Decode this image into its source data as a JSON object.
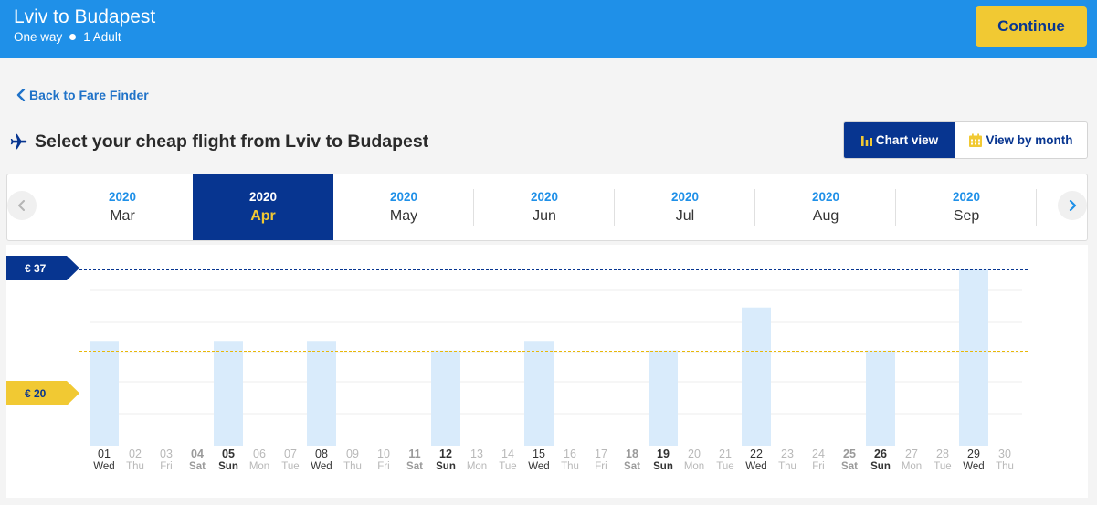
{
  "header": {
    "route_title": "Lviv to Budapest",
    "trip_type": "One way",
    "passengers": "1 Adult",
    "continue_label": "Continue",
    "colors": {
      "bar": "#1f90e8",
      "accent": "#f1c933",
      "navy": "#073590"
    }
  },
  "back_link": "Back to Fare Finder",
  "heading": "Select your cheap flight from Lviv to Budapest",
  "view_toggle": {
    "chart_label": "Chart view",
    "month_label": "View by month",
    "active": "chart"
  },
  "months": [
    {
      "year": "2020",
      "month": "Mar",
      "selected": false
    },
    {
      "year": "2020",
      "month": "Apr",
      "selected": true
    },
    {
      "year": "2020",
      "month": "May",
      "selected": false
    },
    {
      "year": "2020",
      "month": "Jun",
      "selected": false
    },
    {
      "year": "2020",
      "month": "Jul",
      "selected": false
    },
    {
      "year": "2020",
      "month": "Aug",
      "selected": false
    },
    {
      "year": "2020",
      "month": "Sep",
      "selected": false
    }
  ],
  "price_markers": {
    "max_label": "€ 37",
    "min_label": "€ 20"
  },
  "chart_data": {
    "type": "bar",
    "ylim": [
      0,
      37
    ],
    "max_price": 37,
    "min_price": 20,
    "days": [
      {
        "num": "01",
        "name": "Wed",
        "price": 22
      },
      {
        "num": "02",
        "name": "Thu",
        "price": null
      },
      {
        "num": "03",
        "name": "Fri",
        "price": null
      },
      {
        "num": "04",
        "name": "Sat",
        "price": null
      },
      {
        "num": "05",
        "name": "Sun",
        "price": 22
      },
      {
        "num": "06",
        "name": "Mon",
        "price": null
      },
      {
        "num": "07",
        "name": "Tue",
        "price": null
      },
      {
        "num": "08",
        "name": "Wed",
        "price": 22
      },
      {
        "num": "09",
        "name": "Thu",
        "price": null
      },
      {
        "num": "10",
        "name": "Fri",
        "price": null
      },
      {
        "num": "11",
        "name": "Sat",
        "price": null
      },
      {
        "num": "12",
        "name": "Sun",
        "price": 20
      },
      {
        "num": "13",
        "name": "Mon",
        "price": null
      },
      {
        "num": "14",
        "name": "Tue",
        "price": null
      },
      {
        "num": "15",
        "name": "Wed",
        "price": 22
      },
      {
        "num": "16",
        "name": "Thu",
        "price": null
      },
      {
        "num": "17",
        "name": "Fri",
        "price": null
      },
      {
        "num": "18",
        "name": "Sat",
        "price": null
      },
      {
        "num": "19",
        "name": "Sun",
        "price": 20
      },
      {
        "num": "20",
        "name": "Mon",
        "price": null
      },
      {
        "num": "21",
        "name": "Tue",
        "price": null
      },
      {
        "num": "22",
        "name": "Wed",
        "price": 29
      },
      {
        "num": "23",
        "name": "Thu",
        "price": null
      },
      {
        "num": "24",
        "name": "Fri",
        "price": null
      },
      {
        "num": "25",
        "name": "Sat",
        "price": null
      },
      {
        "num": "26",
        "name": "Sun",
        "price": 20
      },
      {
        "num": "27",
        "name": "Mon",
        "price": null
      },
      {
        "num": "28",
        "name": "Tue",
        "price": null
      },
      {
        "num": "29",
        "name": "Wed",
        "price": 37
      },
      {
        "num": "30",
        "name": "Thu",
        "price": null
      }
    ]
  }
}
